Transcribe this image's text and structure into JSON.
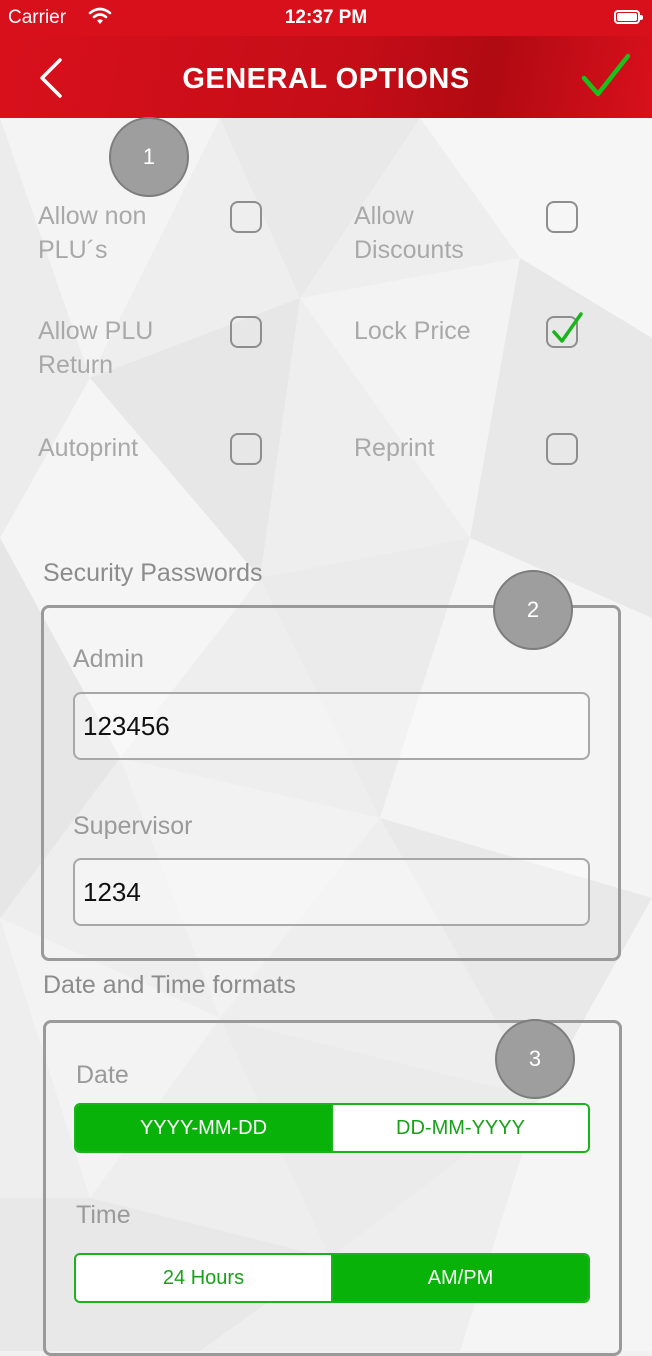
{
  "status_bar": {
    "carrier": "Carrier",
    "time": "12:37 PM"
  },
  "header": {
    "title": "GENERAL OPTIONS"
  },
  "callouts": [
    "1",
    "2",
    "3"
  ],
  "options": [
    {
      "label": "Allow non PLU´s",
      "checked": false
    },
    {
      "label": "Allow Discounts",
      "checked": false
    },
    {
      "label": "Allow PLU Return",
      "checked": false
    },
    {
      "label": "Lock Price",
      "checked": true
    },
    {
      "label": "Autoprint",
      "checked": false
    },
    {
      "label": "Reprint",
      "checked": false
    }
  ],
  "security": {
    "title": "Security Passwords",
    "admin_label": "Admin",
    "admin_value": "123456",
    "supervisor_label": "Supervisor",
    "supervisor_value": "1234"
  },
  "formats": {
    "title": "Date and Time formats",
    "date_label": "Date",
    "date_options": [
      "YYYY-MM-DD",
      "DD-MM-YYYY"
    ],
    "date_selected": "YYYY-MM-DD",
    "time_label": "Time",
    "time_options": [
      "24 Hours",
      "AM/PM"
    ],
    "time_selected": "AM/PM"
  },
  "colors": {
    "brand_red": "#d8101c",
    "accent_green": "#09b209"
  }
}
